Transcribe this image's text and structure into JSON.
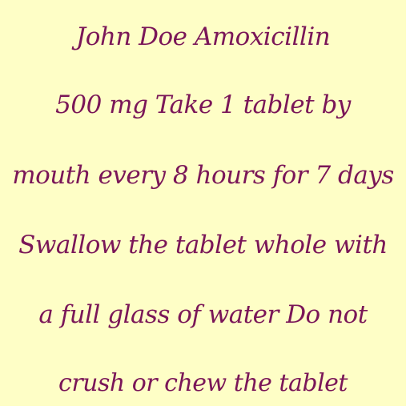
{
  "label": {
    "lines": [
      "John Doe Amoxicillin",
      "500 mg Take 1 tablet by",
      "mouth every 8 hours for 7 days",
      "Swallow the tablet whole with",
      "a full glass of water Do not",
      "crush or chew the tablet"
    ]
  },
  "colors": {
    "background": "#fefec6",
    "text": "#7a1658"
  }
}
